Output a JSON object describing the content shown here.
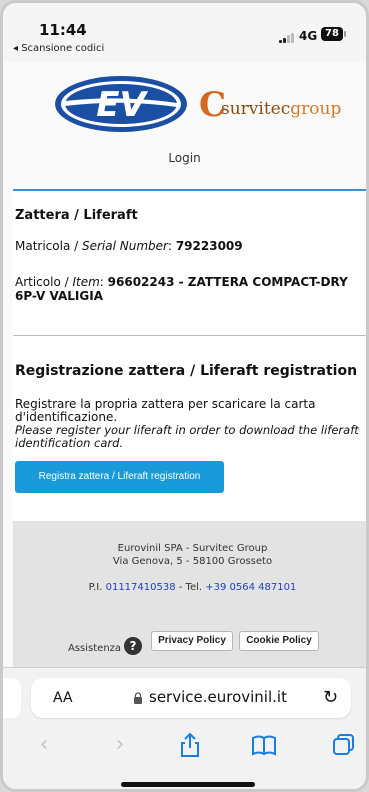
{
  "status_bar": {
    "time": "11:44",
    "back_app": "◂ Scansione codici",
    "network": "4G",
    "battery": "78"
  },
  "brand": {
    "ev_logo_text": "EV",
    "survitec_c": "C",
    "survitec_part1": "survitec",
    "survitec_part2": "group",
    "colors": {
      "ev_blue": "#1b4fa3",
      "survitec_orange": "#d07a2a",
      "accent_blue": "#1a9ad9"
    }
  },
  "header": {
    "login": "Login"
  },
  "liferaft": {
    "title": "Zattera / Liferaft",
    "serial_label": "Matricola / ",
    "serial_label_it": "Serial Number",
    "serial_value": "79223009",
    "item_label": "Articolo / ",
    "item_label_it": "Item",
    "item_value_line1": "96602243 - ZATTERA COMPACT-DRY",
    "item_value_line2": "6P-V VALIGIA"
  },
  "registration": {
    "title": "Registrazione zattera / Liferaft registration",
    "text_it_line1": "Registrare la propria zattera per scaricare la carta",
    "text_it_line2": "d'identificazione.",
    "text_en_line1": "Please register your liferaft in order to download the liferaft",
    "text_en_line2": "identification card.",
    "button": "Registra zattera / Liferaft registration"
  },
  "footer": {
    "company": "Eurovinil SPA - Survitec Group",
    "address": "Via Genova, 5 - 58100 Grosseto",
    "vat_prefix": "P.I. ",
    "vat": "01117410538",
    "tel_prefix": " - Tel. ",
    "tel": "+39 0564 487101",
    "assist": "Assistenza",
    "privacy": "Privacy Policy",
    "cookie": "Cookie Policy"
  },
  "browser": {
    "aa": "AA",
    "url": "service.eurovinil.it",
    "icons": [
      "back-icon",
      "forward-icon",
      "share-icon",
      "bookmarks-icon",
      "tabs-icon"
    ]
  }
}
